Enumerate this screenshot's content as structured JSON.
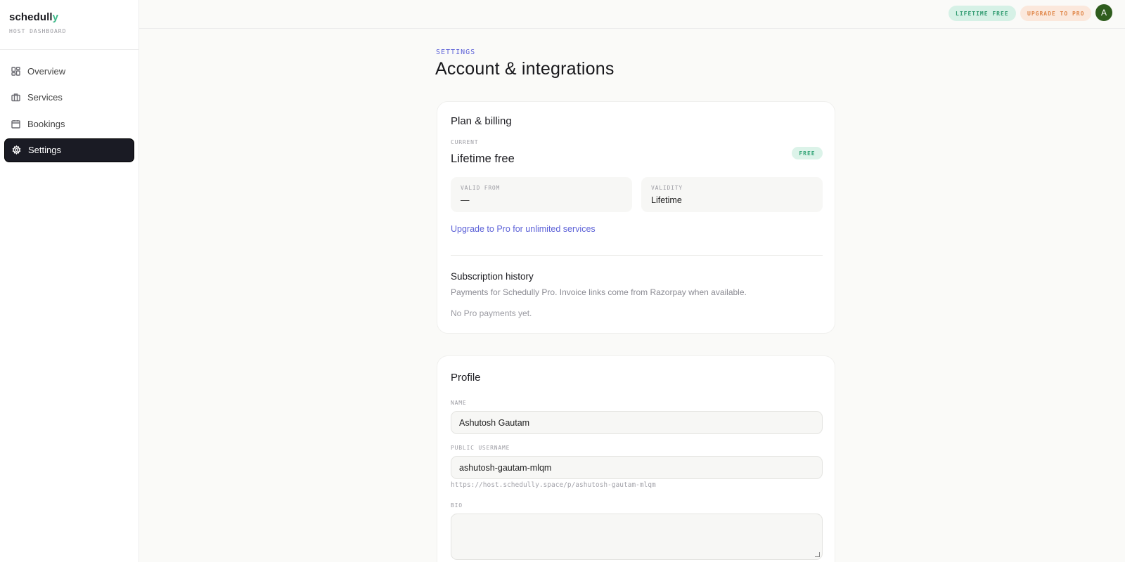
{
  "sidebar": {
    "brand_main": "schedull",
    "brand_accent": "y",
    "brand_sub": "HOST DASHBOARD",
    "items": [
      {
        "label": "Overview",
        "icon": "grid-icon"
      },
      {
        "label": "Services",
        "icon": "briefcase-icon"
      },
      {
        "label": "Bookings",
        "icon": "calendar-icon"
      },
      {
        "label": "Settings",
        "icon": "gear-icon",
        "active": true
      }
    ]
  },
  "topbar": {
    "lifetime_badge": "LIFETIME FREE",
    "upgrade_badge": "UPGRADE TO PRO",
    "avatar_initial": "A"
  },
  "page": {
    "eyebrow": "SETTINGS",
    "title": "Account & integrations"
  },
  "plan": {
    "title": "Plan & billing",
    "current_label": "CURRENT",
    "current_value": "Lifetime free",
    "pill": "FREE",
    "valid_from_label": "VALID FROM",
    "valid_from_value": "—",
    "validity_label": "VALIDITY",
    "validity_value": "Lifetime",
    "upgrade_link": "Upgrade to Pro for unlimited services",
    "history_title": "Subscription history",
    "history_desc": "Payments for Schedully Pro. Invoice links come from Razorpay when available.",
    "history_empty": "No Pro payments yet."
  },
  "profile": {
    "title": "Profile",
    "name_label": "NAME",
    "name_value": "Ashutosh Gautam",
    "username_label": "PUBLIC USERNAME",
    "username_value": "ashutosh-gautam-mlqm",
    "url_hint": "https://host.schedully.space/p/ashutosh-gautam-mlqm",
    "bio_label": "BIO",
    "bio_value": ""
  },
  "colors": {
    "accent": "#5e63d8",
    "brand_green": "#3fb98a",
    "active_nav": "#1a1b24",
    "avatar": "#2f5d1e"
  }
}
